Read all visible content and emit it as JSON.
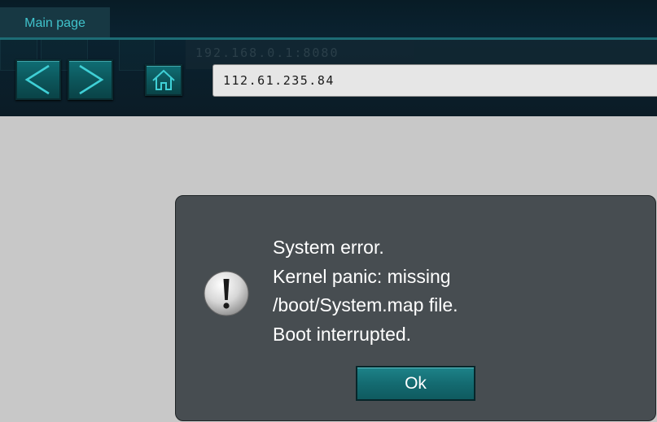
{
  "tab": {
    "label": "Main page"
  },
  "ghost": {
    "url_value": "192.168.0.1:8080"
  },
  "toolbar": {
    "back_icon": "chevron-left-icon",
    "forward_icon": "chevron-right-icon",
    "home_icon": "home-icon"
  },
  "address_bar": {
    "value": "112.61.235.84"
  },
  "dialog": {
    "icon": "exclamation-icon",
    "lines": [
      "System error.",
      "Kernel panic: missing",
      "/boot/System.map file.",
      "Boot interrupted."
    ],
    "ok_label": "Ok"
  },
  "colors": {
    "accent": "#40c3cc",
    "header_bg": "#0a2230",
    "button_teal": "#0f6e74",
    "dialog_bg": "#474d51",
    "page_bg": "#c8c8c8"
  }
}
